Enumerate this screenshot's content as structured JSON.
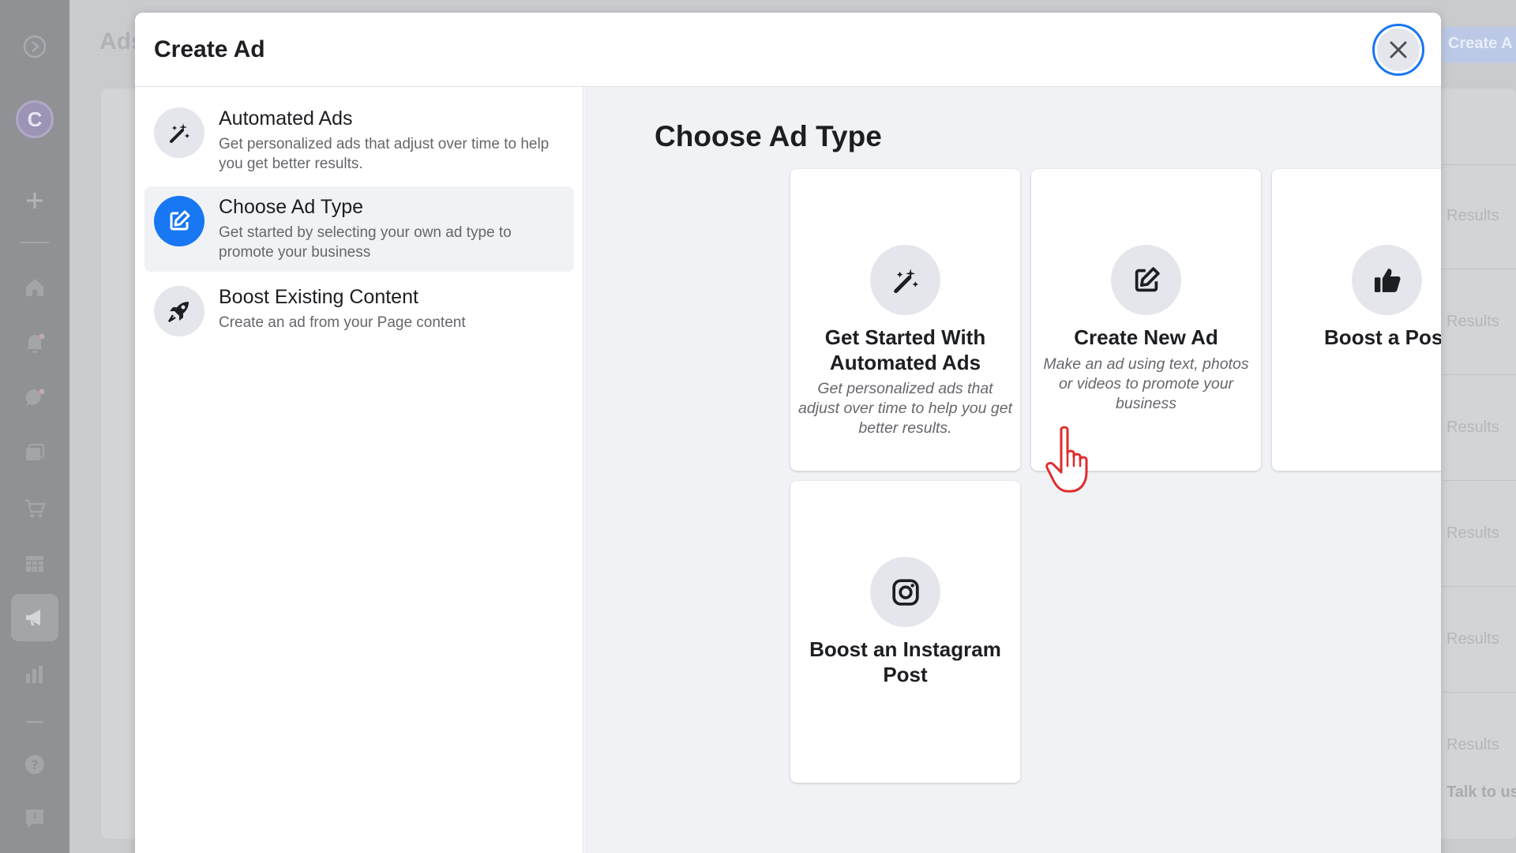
{
  "background": {
    "page_title": "Ads",
    "create_button_label": "Create A",
    "results": [
      "Results",
      "Results",
      "Results",
      "Results",
      "Results",
      "Results"
    ],
    "talk_label": "Talk to us"
  },
  "modal": {
    "title": "Create Ad",
    "close_icon": "close-icon"
  },
  "nav": {
    "items": [
      {
        "title": "Automated Ads",
        "desc": "Get personalized ads that adjust over time to help you get better results.",
        "icon": "magic-wand-icon"
      },
      {
        "title": "Choose Ad Type",
        "desc": "Get started by selecting your own ad type to promote your business",
        "icon": "edit-icon"
      },
      {
        "title": "Boost Existing Content",
        "desc": "Create an ad from your Page content",
        "icon": "rocket-icon"
      }
    ]
  },
  "main": {
    "title": "Choose Ad Type",
    "cards": [
      {
        "title": "Get Started With Automated Ads",
        "desc": "Get personalized ads that adjust over time to help you get better results.",
        "icon": "magic-wand-icon"
      },
      {
        "title": "Create New Ad",
        "desc": "Make an ad using text, photos or videos to promote your business",
        "icon": "edit-icon"
      },
      {
        "title": "Boost a Post",
        "desc": "",
        "icon": "thumbs-up-icon"
      },
      {
        "title": "Boost an Instagram Post",
        "desc": "",
        "icon": "instagram-icon"
      }
    ]
  },
  "colors": {
    "accent": "#1877f2",
    "cursor": "#e02b2b"
  }
}
